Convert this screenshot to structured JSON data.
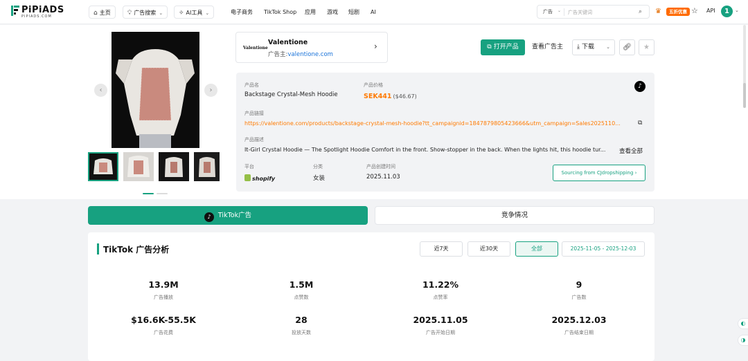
{
  "brand": {
    "name": "PiPiADS",
    "sub": "PIPIADS.COM"
  },
  "nav": {
    "home": "主页",
    "ad_search": "广告搜索",
    "ai_tools": "AI工具",
    "ecommerce": "电子商务",
    "tiktok_shop": "TikTok Shop",
    "apps": "应用",
    "games": "游戏",
    "short_drama": "短剧",
    "ai": "AI"
  },
  "search": {
    "type": "广告",
    "placeholder": "广告关键词"
  },
  "header_right": {
    "promo": "五折优惠",
    "api": "API",
    "avatar": "1"
  },
  "advertiser": {
    "logo_text": "Valentione",
    "name": "Valentione",
    "label": "广告主:",
    "domain": "valentione.com"
  },
  "actions": {
    "open_product": "打开产品",
    "view_advertiser": "查看广告主",
    "download": "下载"
  },
  "product": {
    "name_label": "产品名",
    "name": "Backstage Crystal-Mesh Hoodie",
    "price_label": "产品价格",
    "price": "SEK441",
    "price_usd": "($46.67)",
    "link_label": "产品链接",
    "link": "https://valentione.com/products/backstage-crystal-mesh-hoodie?tt_campaignid=1847879805423666&utm_campaign=Sales2025110...",
    "desc_label": "产品描述",
    "desc": "It-Girl Crystal Hoodie — The Spotlight Hoodie Comfort in the front. Show-stopper in the back. When the lights hit, this hoodie tur...",
    "see_all": "查看全部",
    "platform_label": "平台",
    "platform": "shopify",
    "category_label": "分类",
    "category": "女装",
    "created_label": "产品创建时间",
    "created": "2025.11.03",
    "sourcing": "Sourcing from CJdropshipping"
  },
  "tabs": {
    "tiktok_ads": "TikTok广告",
    "competition": "竞争情况"
  },
  "analytics": {
    "title": "TikTok 广告分析",
    "ranges": [
      "近7天",
      "近30天",
      "全部"
    ],
    "date_start": "2025-11-05",
    "date_sep": "-",
    "date_end": "2025-12-03",
    "stats": [
      {
        "value": "13.9M",
        "label": "广告播放"
      },
      {
        "value": "1.5M",
        "label": "点赞数"
      },
      {
        "value": "11.22%",
        "label": "点赞率"
      },
      {
        "value": "9",
        "label": "广告数"
      },
      {
        "value": "$16.6K-55.5K",
        "label": "广告花费"
      },
      {
        "value": "28",
        "label": "投放天数"
      },
      {
        "value": "2025.11.05",
        "label": "广告开始日期"
      },
      {
        "value": "2025.12.03",
        "label": "广告结束日期"
      }
    ]
  },
  "colors": {
    "accent": "#17a180",
    "price": "#ff7a00",
    "link": "#1a73d9",
    "promo": "#ff6a00"
  }
}
